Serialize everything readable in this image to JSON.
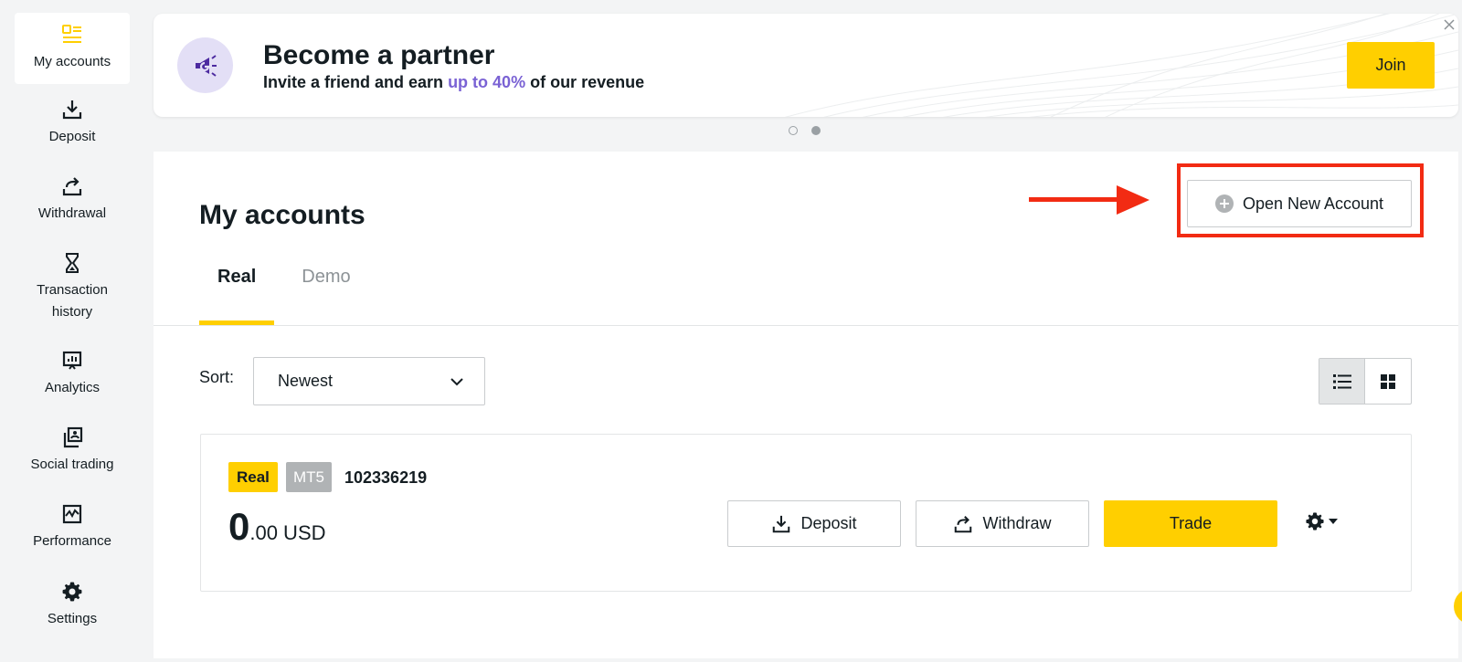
{
  "sidebar": {
    "items": [
      {
        "label": "My accounts",
        "icon": "accounts-icon",
        "active": true
      },
      {
        "label": "Deposit",
        "icon": "deposit-icon"
      },
      {
        "label": "Withdrawal",
        "icon": "withdrawal-icon"
      },
      {
        "label": "Transaction history",
        "icon": "hourglass-icon"
      },
      {
        "label": "Analytics",
        "icon": "analytics-icon"
      },
      {
        "label": "Social trading",
        "icon": "social-trading-icon"
      },
      {
        "label": "Performance",
        "icon": "performance-icon"
      },
      {
        "label": "Settings",
        "icon": "gear-icon"
      }
    ]
  },
  "banner": {
    "title": "Become a partner",
    "subtitle_pre": "Invite a friend and earn ",
    "subtitle_highlight": "up to 40%",
    "subtitle_post": " of our revenue",
    "join_label": "Join",
    "highlight_color": "#7a62d4"
  },
  "main": {
    "title": "My accounts",
    "open_account_label": "Open New Account",
    "tabs": [
      {
        "label": "Real",
        "active": true
      },
      {
        "label": "Demo",
        "active": false
      }
    ],
    "sort_label": "Sort:",
    "sort_value": "Newest"
  },
  "account": {
    "type_badge": "Real",
    "platform_badge": "MT5",
    "number": "102336219",
    "balance_int": "0",
    "balance_dec": ".00 USD",
    "deposit_label": "Deposit",
    "withdraw_label": "Withdraw",
    "trade_label": "Trade"
  },
  "colors": {
    "accent": "#ffcf00",
    "annotation_red": "#f22b13",
    "text": "#141d22"
  }
}
